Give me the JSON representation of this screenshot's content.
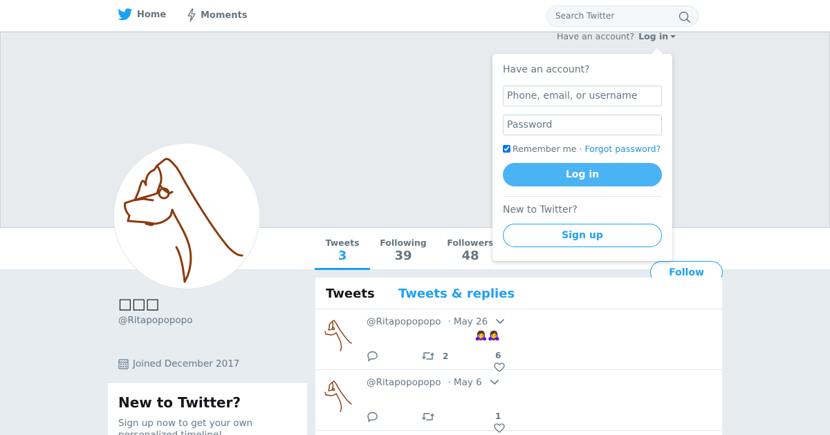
{
  "nav": {
    "home_label": "Home",
    "moments_label": "Moments",
    "search_placeholder": "Search Twitter"
  },
  "login_prompt": {
    "question": "Have an account?",
    "link": "Log in"
  },
  "login_dropdown": {
    "title": "Have an account?",
    "username_placeholder": "Phone, email, or username",
    "password_placeholder": "Password",
    "remember_me": "Remember me",
    "separator": "·",
    "forgot_password": "Forgot password?",
    "login_button": "Log in",
    "new_to_twitter": "New to Twitter?",
    "signup_button": "Sign up"
  },
  "stats": {
    "tweets_label": "Tweets",
    "tweets_value": "3",
    "following_label": "Following",
    "following_value": "39",
    "followers_label": "Followers",
    "followers_value": "48"
  },
  "follow_button": "Follow",
  "profile": {
    "name": "□□□",
    "handle": "@Ritapopopopo",
    "joined": "Joined December 2017"
  },
  "signup_card": {
    "title": "New to Twitter?",
    "text": "Sign up now to get your own personalized timeline!"
  },
  "timeline": {
    "tab_tweets": "Tweets",
    "tab_replies": "Tweets & replies",
    "tweets": [
      {
        "handle": "@Ritapopopopo",
        "date": "May 26",
        "emoji": "🙇‍♀️🙇‍♀️",
        "retweets": "2",
        "likes": "6"
      },
      {
        "handle": "@Ritapopopopo",
        "date": "May 6",
        "emoji": "",
        "retweets": "",
        "likes": "1"
      }
    ]
  },
  "colors": {
    "accent": "#1da1f2",
    "muted": "#657786",
    "page_bg": "#e6ecf0",
    "drawing": "#8b3a0e"
  }
}
